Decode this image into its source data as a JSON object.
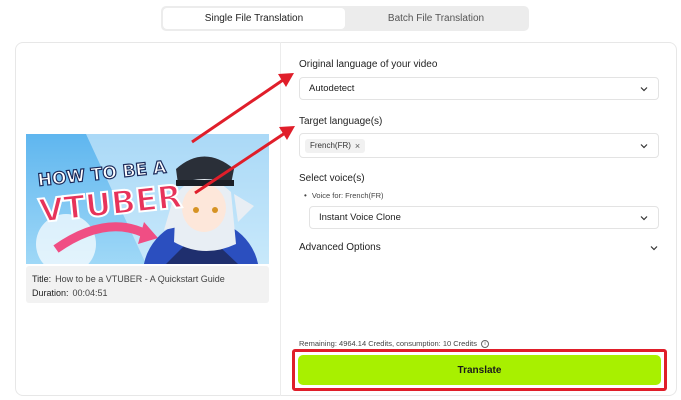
{
  "tabs": [
    {
      "label": "Single File Translation",
      "active": true
    },
    {
      "label": "Batch File Translation",
      "active": false
    }
  ],
  "video": {
    "thumbnail_text_top": "HOW TO BE A",
    "thumbnail_text_main": "VTUBER",
    "title_label": "Title:",
    "title_value": "How to be a VTUBER - A Quickstart Guide",
    "duration_label": "Duration:",
    "duration_value": "00:04:51"
  },
  "form": {
    "original_language_label": "Original language of your video",
    "original_language_value": "Autodetect",
    "target_language_label": "Target language(s)",
    "target_language_chip": "French(FR)",
    "chip_remove": "×",
    "select_voices_label": "Select voice(s)",
    "voice_for": "Voice for: French(FR)",
    "voice_value": "Instant Voice Clone",
    "advanced_options_label": "Advanced Options"
  },
  "footer": {
    "remaining_text": "Remaining: 4964.14 Credits, consumption: 10 Credits",
    "info_glyph": "i",
    "translate_label": "Translate"
  },
  "colors": {
    "translate_bg": "#a8f000",
    "highlight_red": "#e01e2a",
    "arrow_red": "#e01e2a"
  }
}
